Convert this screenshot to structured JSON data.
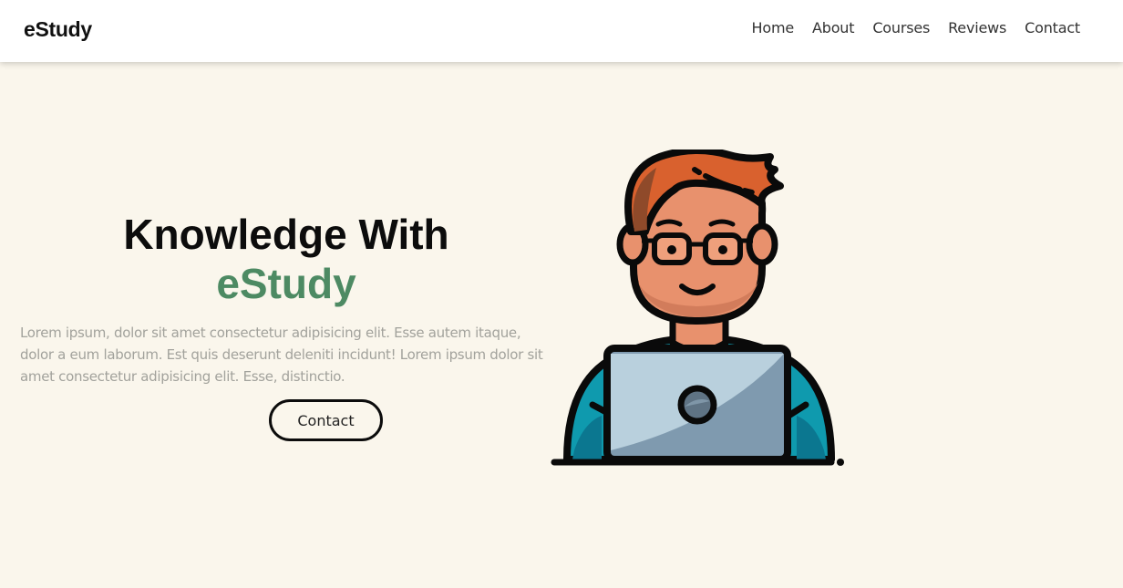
{
  "navbar": {
    "logo": "eStudy",
    "links": [
      "Home",
      "About",
      "Courses",
      "Reviews",
      "Contact"
    ]
  },
  "hero": {
    "title_line1": "Knowledge With",
    "title_line2": "eStudy",
    "description": "Lorem ipsum, dolor sit amet consectetur adipisicing elit. Esse autem itaque, dolor a eum laborum. Est quis deserunt deleniti incidunt! Lorem ipsum dolor sit amet consectetur adipisicing elit. Esse, distinctio.",
    "button_label": "Contact",
    "illustration": "student-with-laptop-illustration"
  },
  "colors": {
    "background": "#faf6ec",
    "accent": "#4d8a63",
    "text": "#0c0c0c",
    "muted_text": "#a2a29c"
  }
}
